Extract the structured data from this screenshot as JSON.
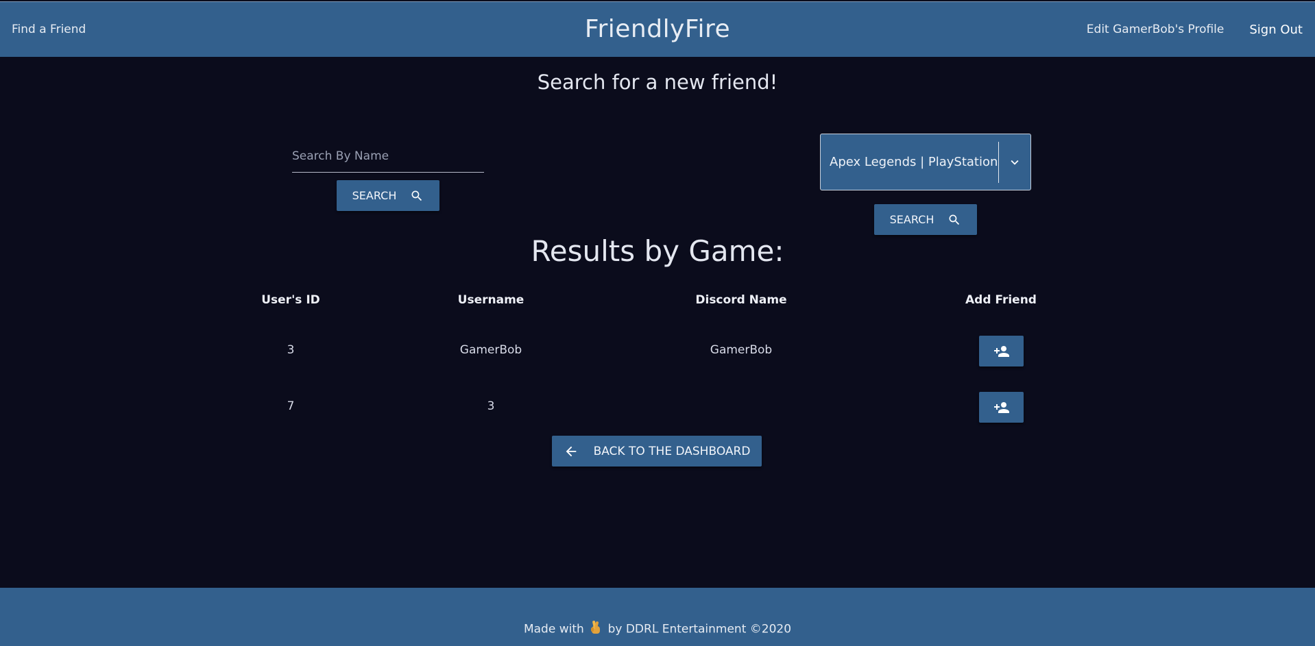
{
  "header": {
    "nav_left": "Find a Friend",
    "brand": "FriendlyFire",
    "edit_profile": "Edit GamerBob's Profile",
    "sign_out": "Sign Out"
  },
  "search": {
    "heading": "Search for a new friend!",
    "name_placeholder": "Search By Name",
    "name_value": "",
    "search_label": "SEARCH",
    "game_selected": "Apex Legends | PlayStation"
  },
  "results": {
    "heading": "Results by Game:",
    "columns": [
      "User's ID",
      "Username",
      "Discord Name",
      "Add Friend"
    ],
    "rows": [
      {
        "id": "3",
        "username": "GamerBob",
        "discord": "GamerBob"
      },
      {
        "id": "7",
        "username": "3",
        "discord": ""
      }
    ]
  },
  "back_button": "BACK TO THE DASHBOARD",
  "footer": {
    "made_with": "Made with",
    "emoji": "🤞",
    "by": "by DDRL Entertainment ©2020"
  },
  "colors": {
    "primary": "#33608d",
    "background": "#0b0c1c",
    "text": "#d8dbe8"
  },
  "icons": {
    "search": "search-icon",
    "dropdown": "chevron-down-icon",
    "add_friend": "person-add-icon",
    "back": "arrow-left-icon",
    "footer_emoji": "crossed-fingers-icon"
  }
}
